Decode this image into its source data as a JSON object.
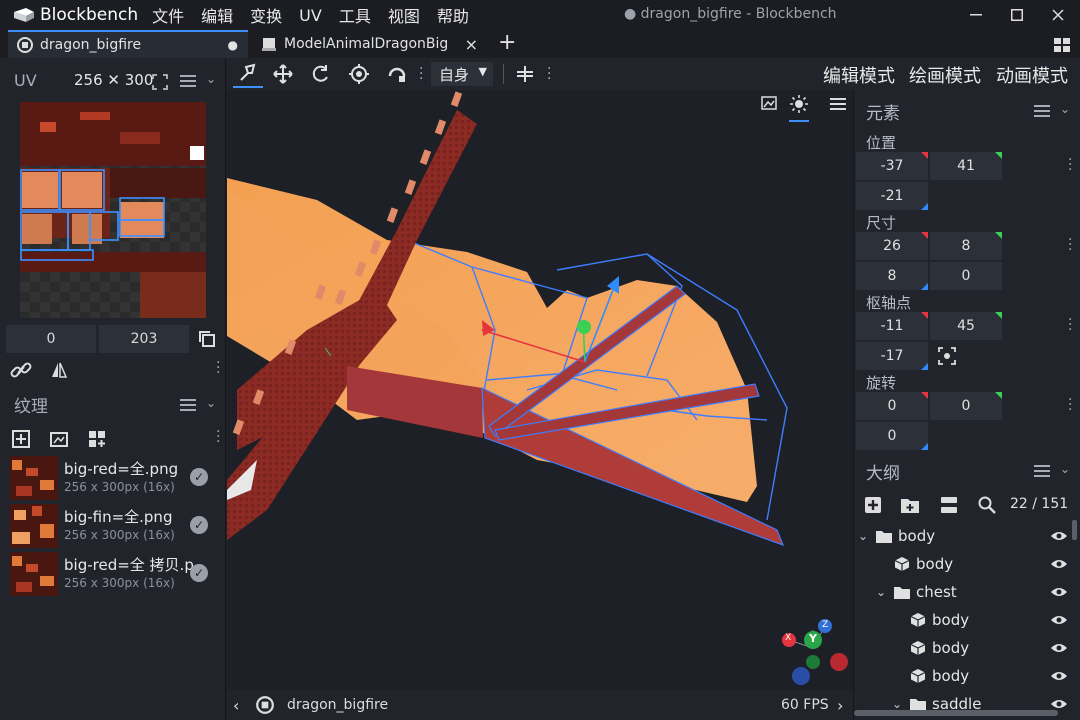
{
  "app": {
    "name": "Blockbench",
    "window_title": "● dragon_bigfire - Blockbench",
    "menus": [
      "文件",
      "编辑",
      "变换",
      "UV",
      "工具",
      "视图",
      "帮助"
    ]
  },
  "tabs": [
    {
      "label": "dragon_bigfire",
      "active": true,
      "dirty_mark": "●"
    },
    {
      "label": "ModelAnimalDragonBig",
      "active": false,
      "close_mark": "×"
    }
  ],
  "tab_add": "+",
  "uv_panel": {
    "title": "UV",
    "size": "256 ✕ 300",
    "offset_x": "0",
    "offset_y": "203"
  },
  "textures_panel": {
    "title": "纹理",
    "items": [
      {
        "name": "big-red=全.png",
        "size": "256 x 300px (16x)"
      },
      {
        "name": "big-fin=全.png",
        "size": "256 x 300px (16x)"
      },
      {
        "name": "big-red=全 拷贝.p",
        "size": "256 x 300px (16x)"
      }
    ]
  },
  "toolbar": {
    "space_select": "自身"
  },
  "modes": [
    "编辑模式",
    "绘画模式",
    "动画模式"
  ],
  "elements_panel": {
    "title": "元素",
    "position_label": "位置",
    "position": [
      "-37",
      "41",
      "-21"
    ],
    "size_label": "尺寸",
    "size": [
      "26",
      "8",
      "8",
      "0"
    ],
    "pivot_label": "枢轴点",
    "pivot": [
      "-11",
      "45",
      "-17"
    ],
    "rotation_label": "旋转",
    "rotation": [
      "0",
      "0",
      "0"
    ]
  },
  "outliner": {
    "title": "大纲",
    "count": "22 / 151",
    "rows": [
      {
        "label": "body",
        "kind": "folder",
        "indent": 0,
        "open": true
      },
      {
        "label": "body",
        "kind": "cube",
        "indent": 1
      },
      {
        "label": "chest",
        "kind": "folder",
        "indent": 1,
        "open": true
      },
      {
        "label": "body",
        "kind": "cube",
        "indent": 2
      },
      {
        "label": "body",
        "kind": "cube",
        "indent": 2
      },
      {
        "label": "body",
        "kind": "cube",
        "indent": 2
      },
      {
        "label": "saddle",
        "kind": "folder",
        "indent": 2,
        "open": true
      }
    ]
  },
  "statusbar": {
    "model_name": "dragon_bigfire",
    "fps": "60 FPS"
  },
  "gizmo_axes": {
    "x": "X",
    "y": "Y",
    "z": "Z"
  },
  "colors": {
    "accent": "#3e90ff",
    "axis_x": "#e5353f",
    "axis_y": "#3ad152",
    "axis_z": "#2f8cff",
    "wing": "#f5a04f",
    "bone": "#8c2a24"
  }
}
